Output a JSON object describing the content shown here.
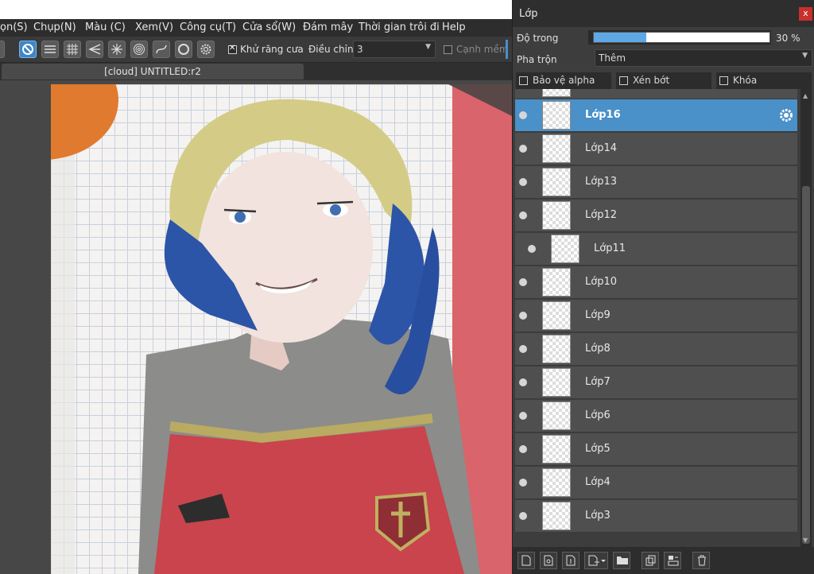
{
  "menu": [
    "ọn(S)",
    "Chụp(N)",
    "Màu (C)",
    "Xem(V)",
    "Công cụ(T)",
    "Cửa sổ(W)",
    "Đám mây",
    "Thời gian trôi đi",
    "Help"
  ],
  "toolbar": {
    "antialias_label": "Khử răng cưa",
    "adjust_label": "Điều chỉnh",
    "adjust_value": "3",
    "soft_edge_label": "Cạnh mềm",
    "antialias_checked": true,
    "soft_edge_checked": false
  },
  "tab": {
    "title": "[cloud] UNTITLED:r2"
  },
  "panel": {
    "title": "Lớp",
    "close": "x",
    "opacity_label": "Độ trong",
    "opacity_value": "30 %",
    "opacity_fraction": 0.3,
    "blend_label": "Pha trộn",
    "blend_value": "Thêm",
    "protect_alpha": "Bảo vệ alpha",
    "clip": "Xén bớt",
    "lock": "Khóa"
  },
  "layers": [
    {
      "name": "Lớp16",
      "selected": true,
      "indented": false
    },
    {
      "name": "Lớp14",
      "selected": false,
      "indented": false
    },
    {
      "name": "Lớp13",
      "selected": false,
      "indented": false
    },
    {
      "name": "Lớp12",
      "selected": false,
      "indented": false
    },
    {
      "name": "Lớp11",
      "selected": false,
      "indented": true
    },
    {
      "name": "Lớp10",
      "selected": false,
      "indented": false
    },
    {
      "name": "Lớp9",
      "selected": false,
      "indented": false
    },
    {
      "name": "Lớp8",
      "selected": false,
      "indented": false
    },
    {
      "name": "Lớp7",
      "selected": false,
      "indented": false
    },
    {
      "name": "Lớp6",
      "selected": false,
      "indented": false
    },
    {
      "name": "Lớp5",
      "selected": false,
      "indented": false
    },
    {
      "name": "Lớp4",
      "selected": false,
      "indented": false
    },
    {
      "name": "Lớp3",
      "selected": false,
      "indented": false
    }
  ],
  "colors": {
    "accent": "#4a90c9",
    "close": "#c8302c",
    "opacity_fill": "#5fa8e6"
  }
}
